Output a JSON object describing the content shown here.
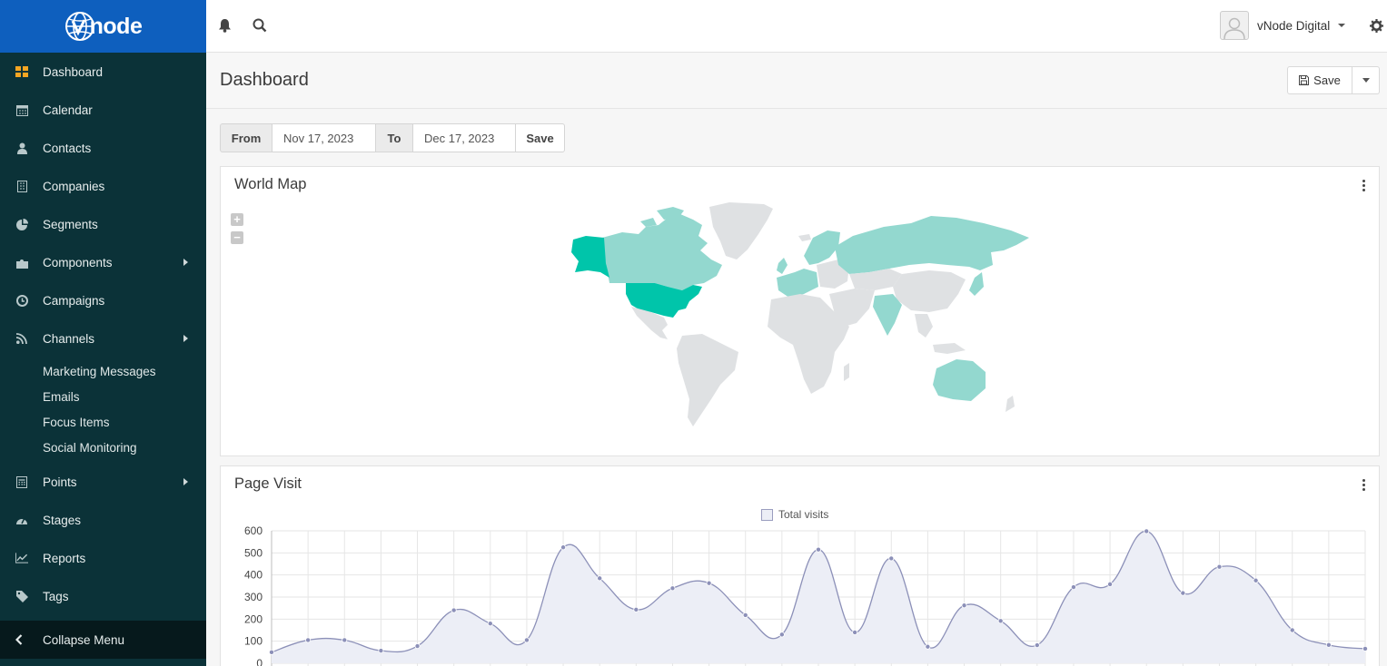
{
  "brand": {
    "logo_text": "node",
    "accent": "#0e5fbe",
    "sidebar_bg": "#0b3238"
  },
  "topbar": {
    "user_name": "vNode Digital"
  },
  "sidebar": {
    "items": [
      {
        "label": "Dashboard",
        "icon": "grid-icon",
        "active": true
      },
      {
        "label": "Calendar",
        "icon": "calendar-icon"
      },
      {
        "label": "Contacts",
        "icon": "user-icon"
      },
      {
        "label": "Companies",
        "icon": "building-icon"
      },
      {
        "label": "Segments",
        "icon": "pie-icon"
      },
      {
        "label": "Components",
        "icon": "puzzle-icon",
        "has_children": true
      },
      {
        "label": "Campaigns",
        "icon": "clock-icon"
      },
      {
        "label": "Channels",
        "icon": "rss-icon",
        "has_children": true
      }
    ],
    "channel_children": [
      "Marketing Messages",
      "Emails",
      "Focus Items",
      "Social Monitoring"
    ],
    "items_after": [
      {
        "label": "Points",
        "icon": "calculator-icon",
        "has_children": true
      },
      {
        "label": "Stages",
        "icon": "dashboard-icon"
      },
      {
        "label": "Reports",
        "icon": "line-chart-icon"
      },
      {
        "label": "Tags",
        "icon": "tag-icon"
      }
    ],
    "collapse_label": "Collapse Menu"
  },
  "header": {
    "title": "Dashboard",
    "save_label": "Save"
  },
  "date_filter": {
    "from_label": "From",
    "from_value": "Nov 17, 2023",
    "to_label": "To",
    "to_value": "Dec 17, 2023",
    "save_label": "Save"
  },
  "world_map": {
    "title": "World Map",
    "zoom_in": "+",
    "zoom_out": "−",
    "highlight_color": "#00c5aa",
    "light_color": "#93d8cf",
    "base_color": "#dfe1e3"
  },
  "page_visit": {
    "title": "Page Visit",
    "chart_data": {
      "type": "area",
      "series": [
        {
          "name": "Total visits",
          "values": [
            50,
            105,
            105,
            57,
            78,
            240,
            180,
            105,
            525,
            385,
            243,
            340,
            363,
            218,
            130,
            515,
            140,
            475,
            75,
            262,
            192,
            82,
            345,
            358,
            598,
            318,
            437,
            375,
            150,
            83,
            66
          ]
        }
      ],
      "ylim": [
        0,
        600
      ],
      "yticks": [
        0,
        100,
        200,
        300,
        400,
        500,
        600
      ],
      "grid": true,
      "legend": "top-center",
      "line_color": "#8c90b8",
      "fill_color": "#eceef6"
    }
  }
}
